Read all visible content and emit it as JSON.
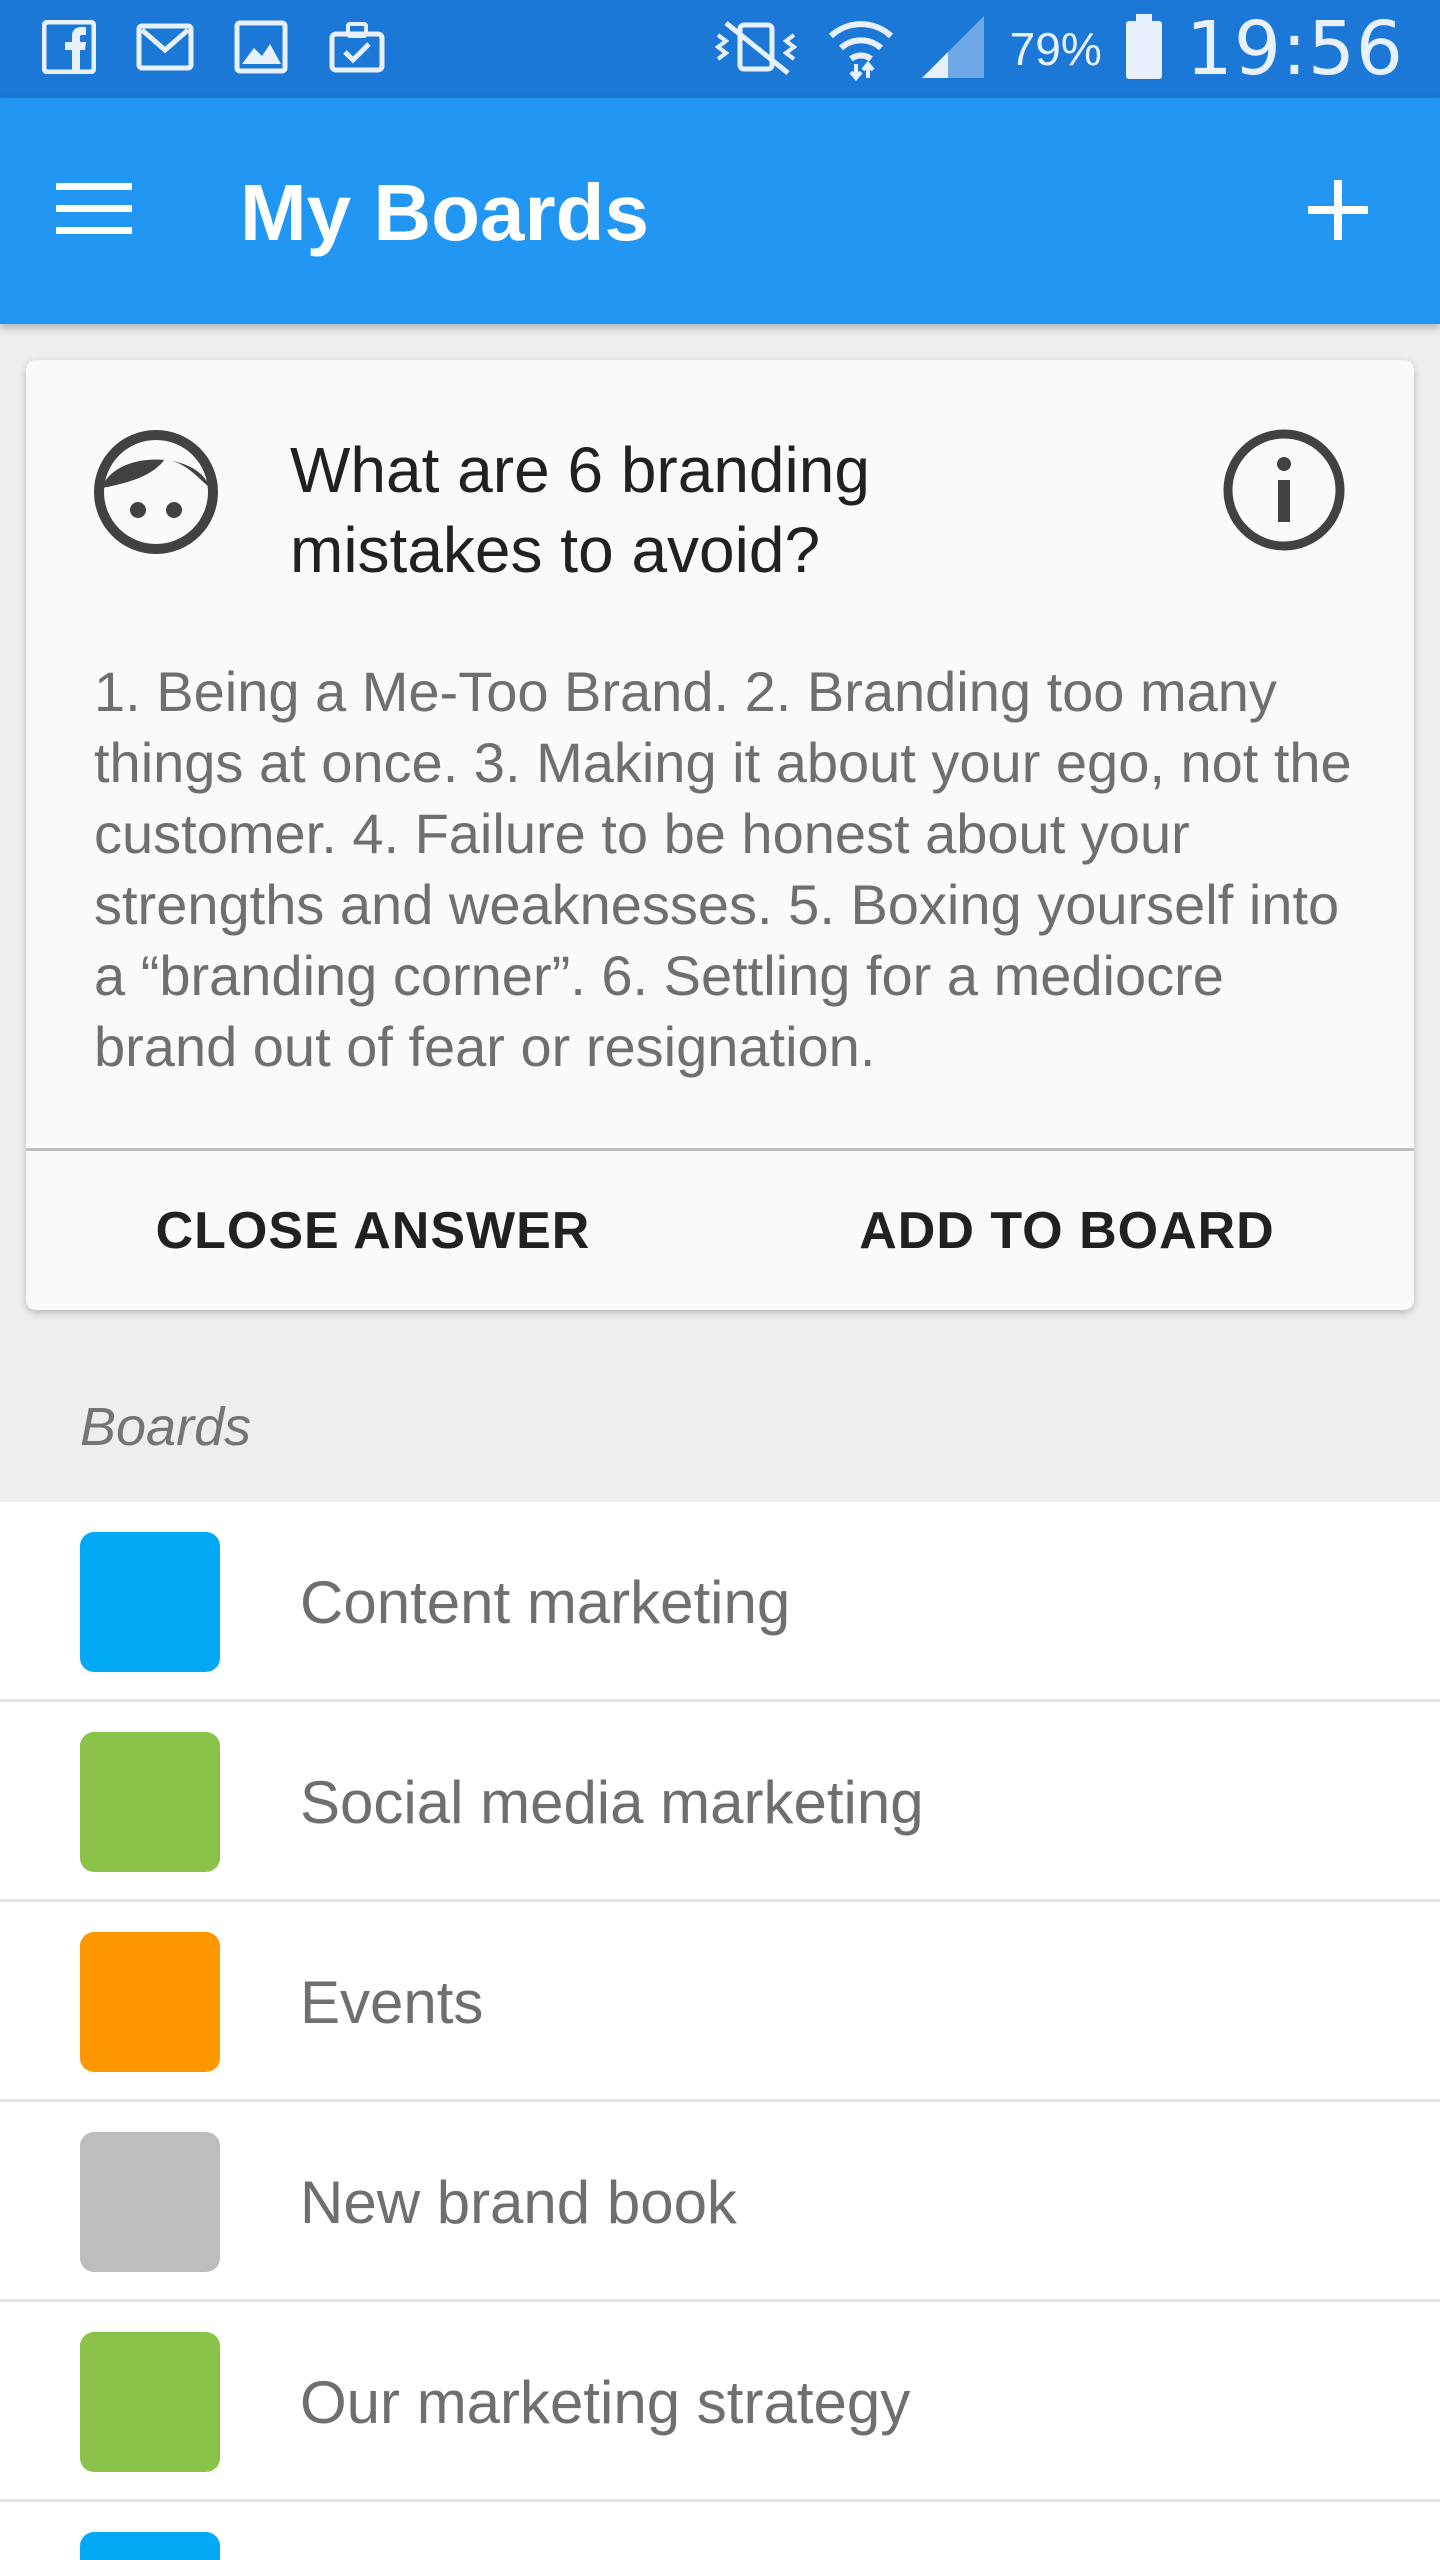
{
  "status_bar": {
    "icons": [
      "facebook-icon",
      "gmail-icon",
      "gallery-icon",
      "briefcase-icon"
    ],
    "battery_percent": "79%",
    "time": "19:56"
  },
  "app_bar": {
    "title": "My Boards",
    "menu_icon": "hamburger-menu-icon",
    "add_icon": "plus-icon"
  },
  "answer_card": {
    "question": "What are 6 branding mistakes to avoid?",
    "answer": "1. Being a Me-Too Brand. 2. Branding too many things at once. 3. Making it about your ego, not the customer. 4. Failure to be honest about your strengths and weaknesses. 5. Boxing yourself into a “branding corner”. 6. Settling for a mediocre brand out of fear or resignation.",
    "close_label": "CLOSE ANSWER",
    "add_label": "ADD TO BOARD"
  },
  "boards": {
    "section_label": "Boards",
    "items": [
      {
        "label": "Content marketing",
        "color": "#03a9f4"
      },
      {
        "label": "Social media marketing",
        "color": "#8bc34a"
      },
      {
        "label": "Events",
        "color": "#ff9800"
      },
      {
        "label": "New brand book",
        "color": "#bdbdbd"
      },
      {
        "label": "Our marketing strategy",
        "color": "#8bc34a"
      },
      {
        "label": "",
        "color": "#03a9f4"
      }
    ]
  }
}
